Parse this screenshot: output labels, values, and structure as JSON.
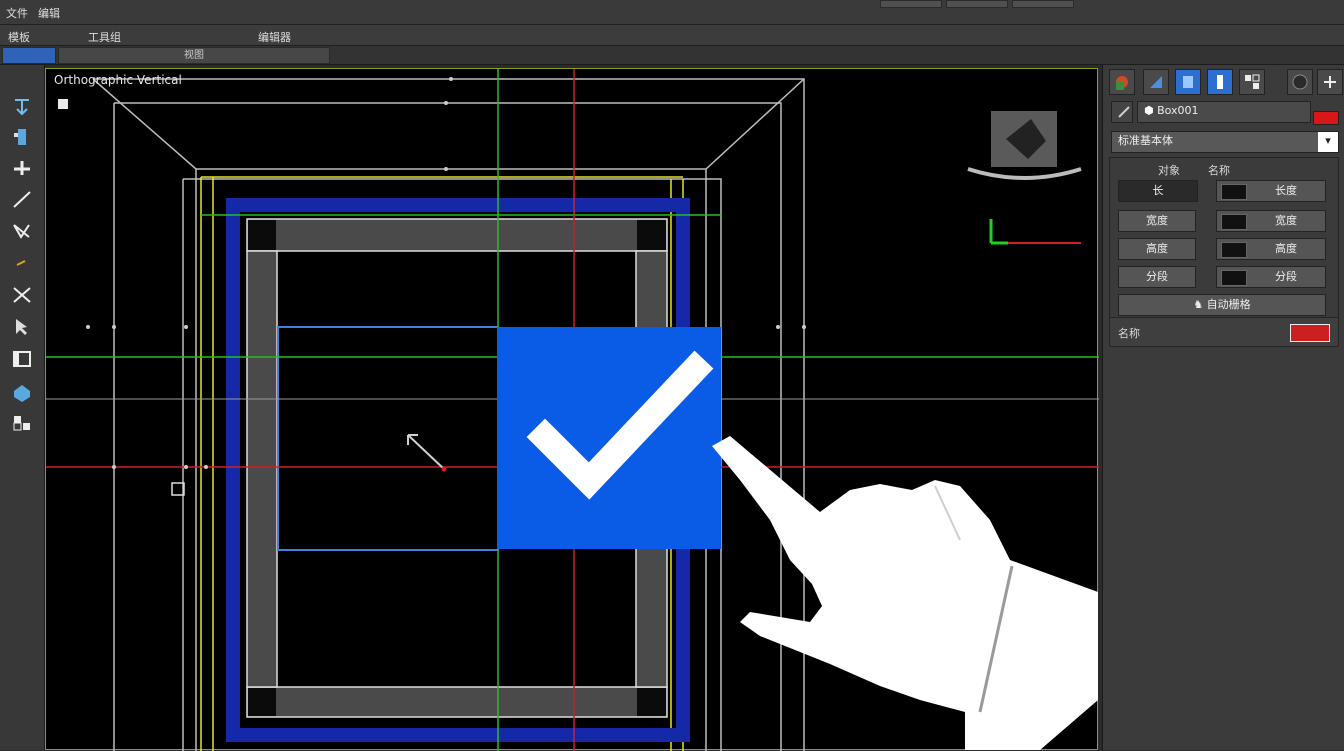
{
  "menubar": {
    "items": [
      "文件",
      "编辑"
    ]
  },
  "toolbar2": {
    "items": [
      "模板",
      "工具组",
      "编辑器"
    ]
  },
  "tabs": {
    "second_tab_label": "视图"
  },
  "viewport": {
    "label": "Orthographic Vertical"
  },
  "right_panel": {
    "object_name": "Box001",
    "dropdown_value": "标准基本体",
    "dropdown_arrow": "▾",
    "section_header_left": "对象",
    "section_header_right": "名称",
    "left_buttons": [
      "长",
      "宽度",
      "高度",
      "分段"
    ],
    "right_fields": [
      "长度",
      "宽度",
      "高度",
      "分段"
    ],
    "wide_button_label": "自动栅格",
    "color_row_label": "名称",
    "accent_red": "#cc1f1f",
    "accent_blue": "#0a5ce6"
  },
  "overlay": {
    "checkbox_state": "checked",
    "checkbox_color": "#0a5ce6",
    "icon_checkmark": "checkmark-icon",
    "icon_hand": "pointing-hand-icon"
  }
}
